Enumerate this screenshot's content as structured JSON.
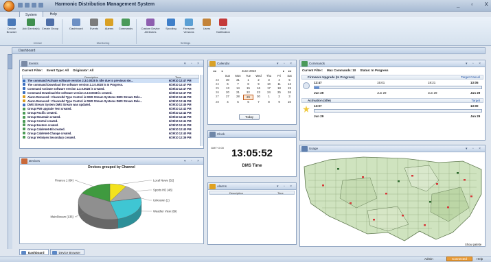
{
  "app": {
    "title": "Harmonic Distribution Management System"
  },
  "window": {
    "minimize": "_",
    "restore": "▫",
    "close": "X"
  },
  "ribbon": {
    "tabs": [
      "System",
      "Help"
    ],
    "buttons": [
      {
        "label": "Device Browser",
        "color": "#4a79b8"
      },
      {
        "label": "Add Device(s)",
        "color": "#3f8f4f"
      },
      {
        "label": "Create Group",
        "color": "#4f6fa8"
      },
      {
        "label": "Dashboard",
        "color": "#6c8fc4"
      },
      {
        "label": "Events",
        "color": "#7c7c7c"
      },
      {
        "label": "Alarms",
        "color": "#d9a126"
      },
      {
        "label": "Commands",
        "color": "#4b9a5a"
      },
      {
        "label": "Custom Device Attributes",
        "color": "#8e5fb0"
      },
      {
        "label": "Spooling",
        "color": "#3f7fc9"
      },
      {
        "label": "Firmware Versions",
        "color": "#5a9fd4"
      },
      {
        "label": "Users",
        "color": "#c4843a"
      },
      {
        "label": "Alert Notification",
        "color": "#c43a3a"
      }
    ],
    "groups": [
      "Device",
      "Monitoring",
      "Settings"
    ]
  },
  "dashboard_tab": "Dashboard",
  "events": {
    "title": "Events",
    "filter_label": "Current Filter:",
    "filter_type": "Event Type: All",
    "filter_origin": "Originator: All",
    "col_description": "Description",
    "col_time": "Time",
    "rows": [
      {
        "d": "The command Activate software version 2.3.0.0028 is Idle due to previous ste...",
        "t": "6/29/10 12:47 PM",
        "c": "#3b6fbf"
      },
      {
        "d": "The command Download the software version 2.3.0.0028 is In Progress.",
        "t": "6/29/10 12:47 PM",
        "c": "#3b6fbf"
      },
      {
        "d": "Command Activate software version 2.3.0.0028 is created.",
        "t": "6/29/10 12:47 PM",
        "c": "#3b6fbf"
      },
      {
        "d": "Command Download the software version 2.3.0.0028 is created.",
        "t": "6/29/10 12:47 PM",
        "c": "#3b6fbf"
      },
      {
        "d": "Alarm Removed : ChannelId Type Control is DMS Stream Systems DMS Stream Rele...",
        "t": "6/29/10 12:46 PM",
        "c": "#d99b1f"
      },
      {
        "d": "Alarm Removed : ChannelId Type Control is DMS Stream Systems DMS Stream Rele...",
        "t": "6/29/10 12:46 PM",
        "c": "#d99b1f"
      },
      {
        "d": "DMS Stream System DMS Stream was updated.",
        "t": "6/29/10 12:45 PM",
        "c": "#3b6fbf"
      },
      {
        "d": "Group PWI upgrade Test created.",
        "t": "6/29/10 12:42 PM",
        "c": "#4a9a55"
      },
      {
        "d": "Group Pacific created.",
        "t": "6/29/10 12:42 PM",
        "c": "#4a9a55"
      },
      {
        "d": "Group Mountain created.",
        "t": "6/29/10 12:42 PM",
        "c": "#4a9a55"
      },
      {
        "d": "Group Central created.",
        "t": "6/29/10 12:41 PM",
        "c": "#4a9a55"
      },
      {
        "d": "Group Eastern created.",
        "t": "6/29/10 12:41 PM",
        "c": "#4a9a55"
      },
      {
        "d": "Group CableNet-Bit created.",
        "t": "6/29/10 12:40 PM",
        "c": "#4a9a55"
      },
      {
        "d": "Group CableNet-Change created.",
        "t": "6/29/10 12:40 PM",
        "c": "#4a9a55"
      },
      {
        "d": "Group Yetisiyen Secondary created.",
        "t": "6/29/10 12:39 PM",
        "c": "#4a9a55"
      }
    ]
  },
  "calendar": {
    "title": "Calendar",
    "prev_year": "◂◂",
    "prev": "◂",
    "month": "June 2010",
    "next": "▸",
    "next_year": "▸▸",
    "headers": [
      "",
      "Sun",
      "Mon",
      "Tue",
      "Wed",
      "Thu",
      "Fri",
      "Sat"
    ],
    "weeks": [
      [
        "23",
        "30",
        "31",
        "1",
        "2",
        "3",
        "4",
        "5"
      ],
      [
        "24",
        "6",
        "7",
        "8",
        "9",
        "10",
        "11",
        "12"
      ],
      [
        "25",
        "13",
        "14",
        "15",
        "16",
        "17",
        "18",
        "19"
      ],
      [
        "26",
        "20",
        "21",
        "22",
        "23",
        "24",
        "25",
        "26"
      ],
      [
        "27",
        "27",
        "28",
        "29",
        "30",
        "1",
        "2",
        "3"
      ],
      [
        "28",
        "4",
        "5",
        "6",
        "7",
        "8",
        "9",
        "10"
      ]
    ],
    "today_label": "Today"
  },
  "clock": {
    "title": "Clock",
    "gmt": "GMT+2:00",
    "time": "13:05:52",
    "zone": "DMS Time"
  },
  "alarms": {
    "title": "Alarms",
    "col_description": "Description",
    "col_time": "Time"
  },
  "commands": {
    "title": "Commands",
    "filter_label": "Current Filter:",
    "filter_type": "Max Commands: 10",
    "filter_status": "Status: In Progress",
    "sections": [
      {
        "name": "Firmware Upgrade (In Progress)",
        "links": [
          "Target",
          "Cancel"
        ],
        "start": "12:47",
        "ticks": [
          "15:01",
          "18:21"
        ],
        "end": "13:05",
        "progress": 0.03,
        "dates": [
          "Jun 29",
          "Jun 29",
          "Jun 29",
          "Jun 29"
        ]
      },
      {
        "name": "Activation (Idle)",
        "links": [
          "Target"
        ],
        "start": "13:07",
        "end": "13:00",
        "progress": 0.0,
        "dates": [
          "Jun 29",
          "Jun 29"
        ]
      }
    ]
  },
  "devices": {
    "title": "Devices",
    "chart_title": "Devices grouped by Channel",
    "slices": [
      {
        "name": "Local News (32)",
        "value": 32,
        "color": "#f3e21d"
      },
      {
        "name": "Sports HD (48)",
        "value": 48,
        "color": "#a8a8a8"
      },
      {
        "name": "Unknown (1)",
        "value": 1,
        "color": "#6a68c9"
      },
      {
        "name": "Weather View (89)",
        "value": 89,
        "color": "#3fc6d3"
      },
      {
        "name": "MainStream (136)",
        "value": 136,
        "color": "#8f8f8f"
      },
      {
        "name": "Finance 1 (64)",
        "value": 64,
        "color": "#3f9a3f"
      }
    ]
  },
  "usage": {
    "title": "Usage",
    "show_palette": "Show palette"
  },
  "bottom_tabs": [
    "Dashboard",
    "Device Browser"
  ],
  "status": {
    "user": "Admin",
    "connection": "Connected",
    "help": "Help"
  }
}
